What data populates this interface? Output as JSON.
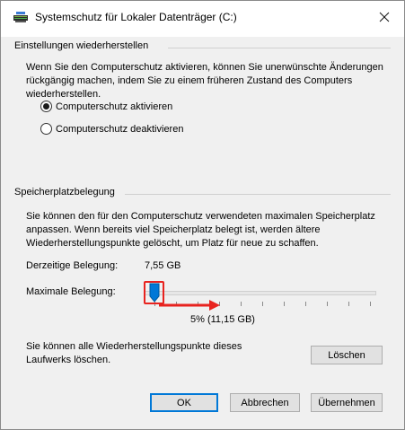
{
  "window": {
    "title": "Systemschutz für Lokaler Datenträger (C:)",
    "app_icon": "system-protection-icon",
    "close_icon": "close-icon"
  },
  "restore_section": {
    "heading": "Einstellungen wiederherstellen",
    "description_lines": [
      "Wenn Sie den Computerschutz aktivieren, können Sie unerwünschte Änderungen",
      "rückgängig machen, indem Sie zu einem früheren Zustand des Computers",
      "wiederherstellen."
    ],
    "options": [
      {
        "label": "Computerschutz aktivieren",
        "selected": true
      },
      {
        "label": "Computerschutz deaktivieren",
        "selected": false
      }
    ]
  },
  "storage_section": {
    "heading": "Speicherplatzbelegung",
    "description_lines": [
      "Sie können den für den Computerschutz verwendeten maximalen Speicherplatz",
      "anpassen. Wenn bereits viel Speicherplatz belegt ist, werden ältere",
      "Wiederherstellungspunkte gelöscht, um Platz für neue zu schaffen."
    ],
    "current_usage_label": "Derzeitige Belegung:",
    "current_usage_value": "7,55 GB",
    "max_usage_label": "Maximale Belegung:",
    "max_usage_value_text": "5% (11,15 GB)",
    "max_usage_percent": 5,
    "delete_text_lines": [
      "Sie können alle Wiederherstellungspunkte dieses",
      "Laufwerks löschen."
    ],
    "delete_button": "Löschen"
  },
  "annotation_color": "#e8231f",
  "accent_color": "#0078d7",
  "footer": {
    "ok": "OK",
    "cancel": "Abbrechen",
    "apply": "Übernehmen"
  }
}
